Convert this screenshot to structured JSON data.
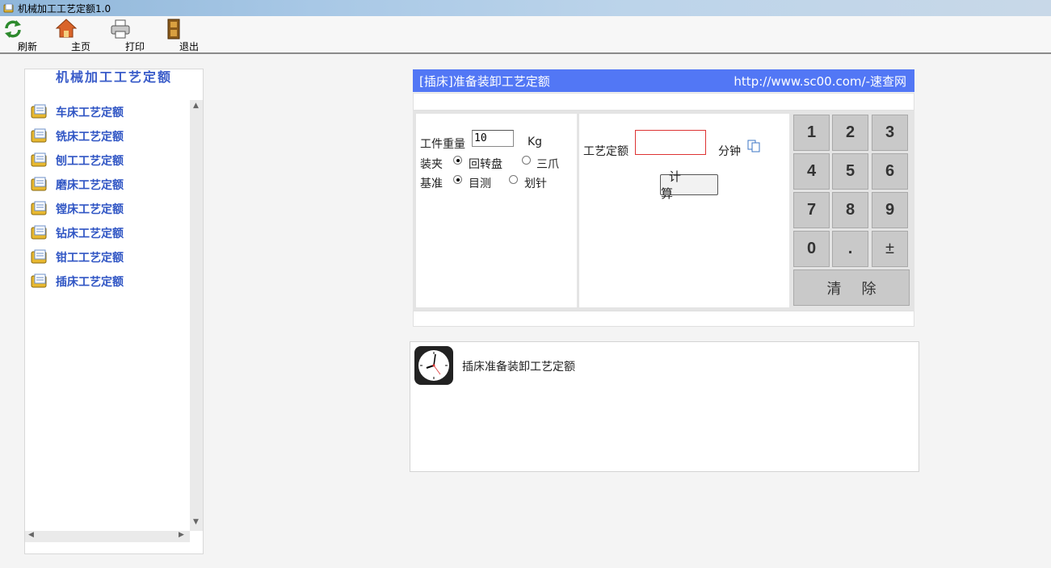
{
  "window": {
    "title": "机械加工工艺定额1.0"
  },
  "toolbar": {
    "refresh_label": "刷新",
    "home_label": "主页",
    "print_label": "打印",
    "exit_label": "退出"
  },
  "sidebar": {
    "title": "机械加工工艺定额",
    "items": [
      {
        "label": "车床工艺定额"
      },
      {
        "label": "铣床工艺定额"
      },
      {
        "label": "刨工工艺定额"
      },
      {
        "label": "磨床工艺定额"
      },
      {
        "label": "镗床工艺定额"
      },
      {
        "label": "钻床工艺定额"
      },
      {
        "label": "钳工工艺定额"
      },
      {
        "label": "插床工艺定额"
      }
    ]
  },
  "calculator": {
    "header_title": "[插床]准备装卸工艺定额",
    "header_link": "http://www.sc00.com/-速查网",
    "weight_label": "工件重量",
    "weight_value": "10",
    "weight_unit": "Kg",
    "clamp_label": "装夹",
    "clamp_options": [
      "回转盘",
      "三爪"
    ],
    "clamp_selected": "回转盘",
    "datum_label": "基准",
    "datum_options": [
      "目测",
      "划针"
    ],
    "datum_selected": "目测",
    "result_label": "工艺定额",
    "result_value": "",
    "result_unit": "分钟",
    "calc_button": "计 算",
    "keypad": [
      "1",
      "2",
      "3",
      "4",
      "5",
      "6",
      "7",
      "8",
      "9",
      "0",
      ".",
      "±"
    ],
    "clear_button": "清 除"
  },
  "info": {
    "description": "插床准备装卸工艺定额"
  },
  "colors": {
    "header_bg": "#5277f5",
    "link_text": "#2f55c4",
    "result_border": "#dd3333"
  }
}
